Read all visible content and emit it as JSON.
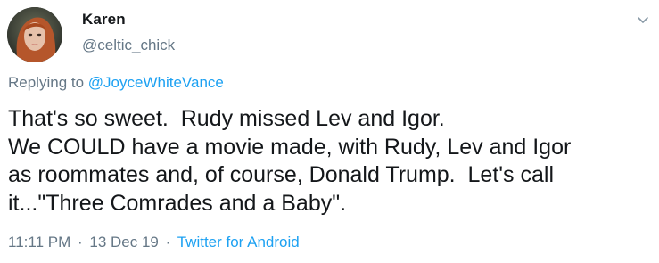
{
  "author": {
    "display_name": "Karen",
    "handle": "@celtic_chick"
  },
  "reply": {
    "prefix": "Replying to",
    "mention": "@JoyceWhiteVance"
  },
  "tweet": {
    "lines": [
      "That's so sweet.  Rudy missed Lev and Igor.",
      "We COULD have a movie made, with Rudy, Lev and Igor",
      "as roommates and, of course, Donald Trump.  Let's call",
      "it...\"Three Comrades and a Baby\"."
    ]
  },
  "meta": {
    "time": "11:11 PM",
    "separator": "·",
    "date": "13 Dec 19",
    "source": "Twitter for Android"
  },
  "icons": {
    "menu": "chevron-down-icon",
    "avatar": "profile-photo"
  },
  "colors": {
    "text": "#14171a",
    "secondary": "#657786",
    "link": "#1da1f2"
  }
}
